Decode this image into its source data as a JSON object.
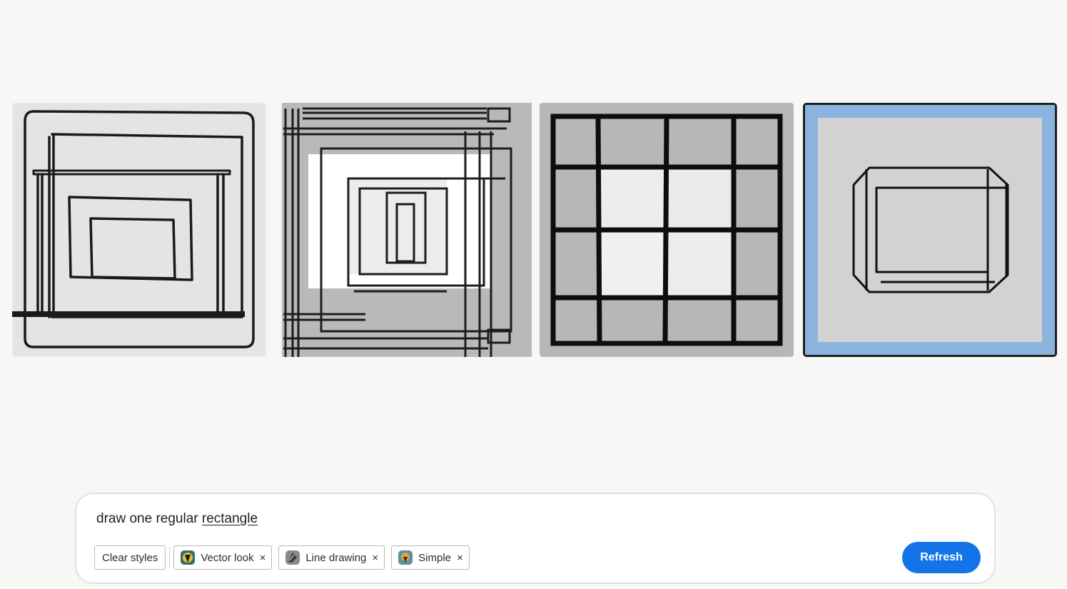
{
  "gallery": {
    "images": [
      {
        "name": "result-image-1",
        "selected": false
      },
      {
        "name": "result-image-2",
        "selected": false
      },
      {
        "name": "result-image-3",
        "selected": false
      },
      {
        "name": "result-image-4",
        "selected": true
      }
    ]
  },
  "prompt": {
    "text_before": "draw one regular ",
    "text_misspelled": "rectangle"
  },
  "styles": {
    "clear_label": "Clear styles",
    "chips": [
      {
        "label": "Vector look",
        "icon": "vector-look-thumbnail",
        "remove": "×"
      },
      {
        "label": "Line drawing",
        "icon": "line-drawing-thumbnail",
        "remove": "×"
      },
      {
        "label": "Simple",
        "icon": "simple-thumbnail",
        "remove": "×"
      }
    ]
  },
  "actions": {
    "refresh_label": "Refresh"
  },
  "colors": {
    "accent": "#1473e6",
    "background": "#f7f7f6",
    "selected_border": "#1f1f1f"
  }
}
